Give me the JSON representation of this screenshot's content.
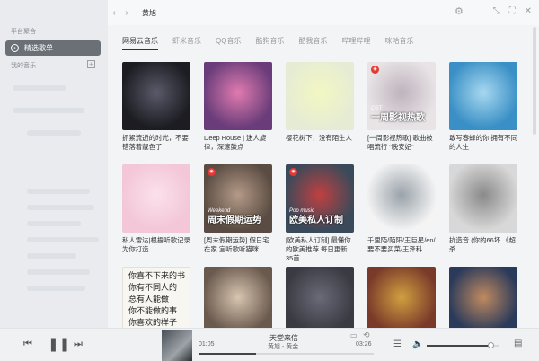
{
  "sidebar": {
    "section1": "平台聚合",
    "active_item": "精选歌单",
    "section2": "我的音乐"
  },
  "topbar": {
    "search_value": "黄旭"
  },
  "tabs": [
    "网易云音乐",
    "虾米音乐",
    "QQ音乐",
    "酷狗音乐",
    "酷我音乐",
    "哔哩哔哩",
    "咪咕音乐"
  ],
  "playlists": [
    {
      "title": "抓紧流逝的时光，不要错落着靓色了",
      "bg": "#1c1c22",
      "accent": "#5a5a6a"
    },
    {
      "title": "Deep House | 迷人旋律，深邃鼓点",
      "bg": "#6a3d7a",
      "accent": "#e07bb0"
    },
    {
      "title": "樱花树下，没有陌生人",
      "bg": "#e6ecd4",
      "accent": "#f3f7c2"
    },
    {
      "title": "[一周影视热歌] 歌曲被唱流行 \"晚安妃\"",
      "bg": "#e8e4e6",
      "accent": "#bfb3bd",
      "badge": true,
      "overlay": "一周影视热歌",
      "overlay_small": "OST"
    },
    {
      "title": "敢写春蜂的你 拥有不同的人生",
      "bg": "#3a90c6",
      "accent": "#a8d8f0"
    },
    {
      "title": "私人雷达|根据听歌记录为你打造",
      "bg": "#f3c6d8",
      "accent": "#fbe1ea"
    },
    {
      "title": "[周末假期运势] 假日宅在家 宜听歌听猫咪",
      "bg": "#5a4c42",
      "accent": "#b49a88",
      "badge": true,
      "overlay": "周末假期运势",
      "overlay_small": "Weekend"
    },
    {
      "title": "[欧美私人订制] 最懂你的欧美推荐 每日更新35首",
      "bg": "#3a4a5a",
      "accent": "#c04040",
      "badge": true,
      "overlay": "欧美私人订制",
      "overlay_small": "Pop music"
    },
    {
      "title": "千里陌/陌阳/王巨星/en/要不要买菜/王泽科",
      "bg": "#f4f4f4",
      "accent": "#9aa2aa"
    },
    {
      "title": "抗造音 (你的66坏 《超杀",
      "bg": "#d8d8d8",
      "accent": "#8a8a8a"
    },
    {
      "title": "",
      "bg": "#f8f6f0",
      "accent": "#ccc",
      "text_image": true
    },
    {
      "title": "",
      "bg": "#6a5a4e",
      "accent": "#d8c4b0"
    },
    {
      "title": "",
      "bg": "#3a3a42",
      "accent": "#6a6a78"
    },
    {
      "title": "",
      "bg": "#7a3a2a",
      "accent": "#d0a040"
    },
    {
      "title": "",
      "bg": "#2a3a5a",
      "accent": "#c08a60"
    }
  ],
  "calligraphy": [
    "你喜不下来的书",
    "你有不同人的",
    "总有人能做",
    "你不能做的事",
    "你喜欢的样子"
  ],
  "player": {
    "current_time": "01:05",
    "total_time": "03:26",
    "song": "天堂来信",
    "artist": "黄旭 - 黄金",
    "progress": 0.33,
    "volume": 0.9
  }
}
